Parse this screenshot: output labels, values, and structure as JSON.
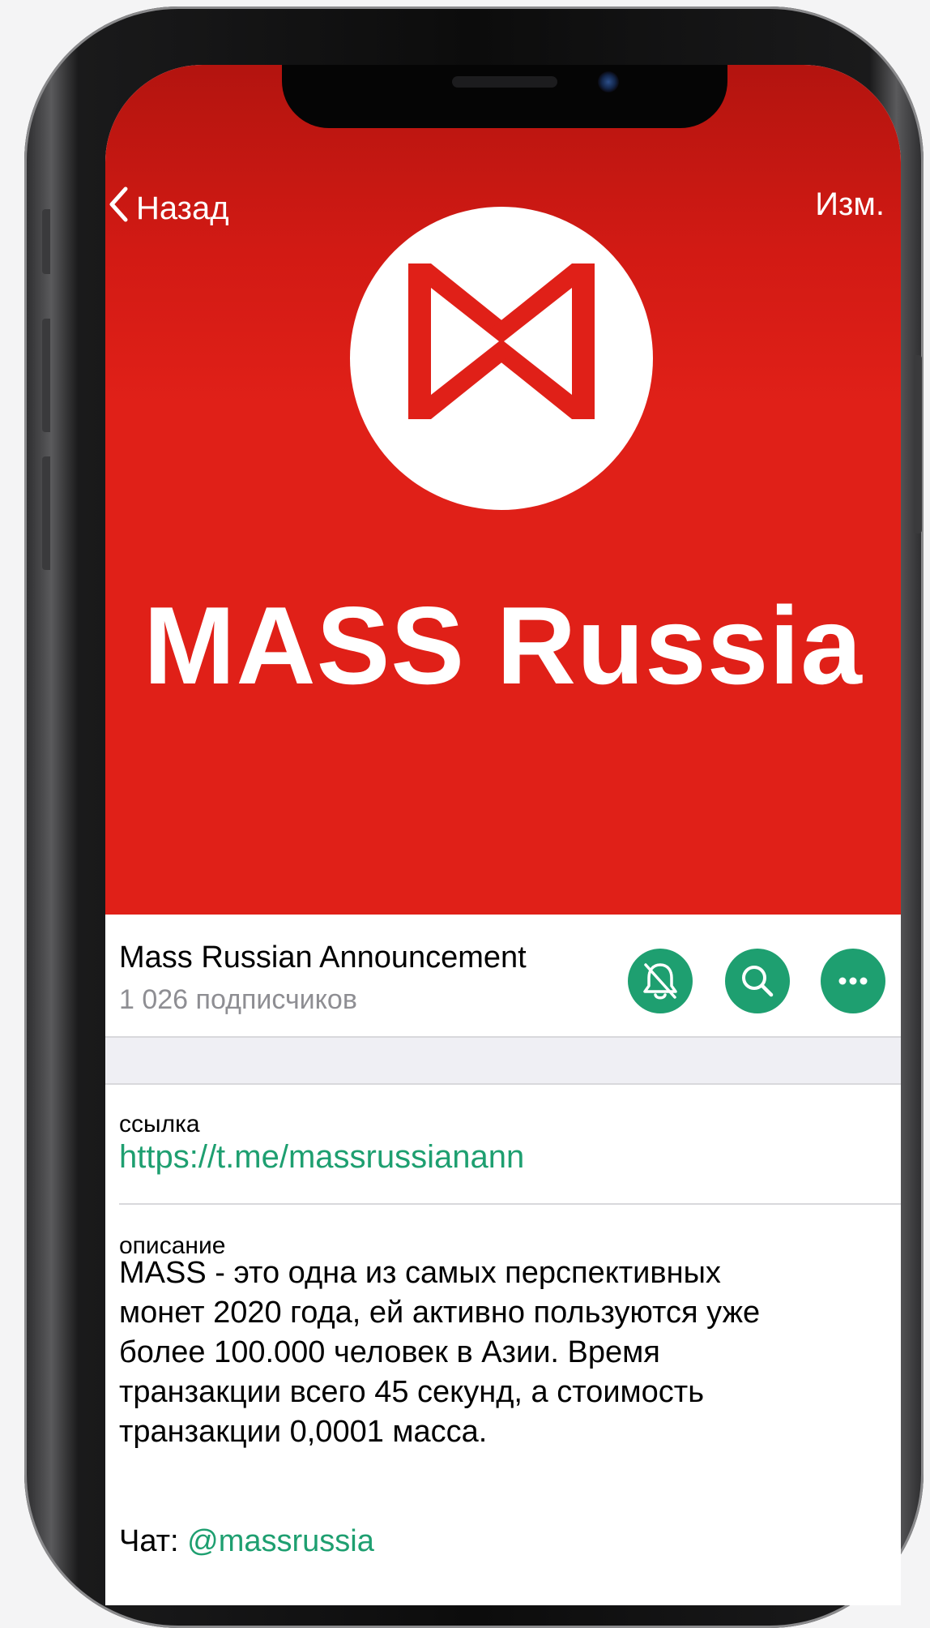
{
  "nav": {
    "back_label": "Назад",
    "edit_label": "Изм."
  },
  "banner": {
    "brand_title": "MASS Russia",
    "background_color": "#e02018",
    "logo_icon": "mass-logo"
  },
  "channel": {
    "name": "Mass Russian Announcement",
    "subscribers": "1 026 подписчиков",
    "actions": [
      {
        "name": "mute",
        "icon": "bell-slash-icon"
      },
      {
        "name": "search",
        "icon": "search-icon"
      },
      {
        "name": "more",
        "icon": "more-icon"
      }
    ],
    "accent_color": "#1e9f70"
  },
  "info": {
    "link_label": "ссылка",
    "link_value": "https://t.me/massrussianann",
    "description_label": "описание",
    "description_text": "MASS - это одна из самых перспективных\nмонет 2020 года, ей активно пользуются уже\nболее 100.000 человек в Азии. Время\nтранзакции всего 45 секунд, а стоимость\nтранзакции 0,0001 масса.",
    "chat_label": "Чат: ",
    "chat_link": "@massrussia"
  }
}
